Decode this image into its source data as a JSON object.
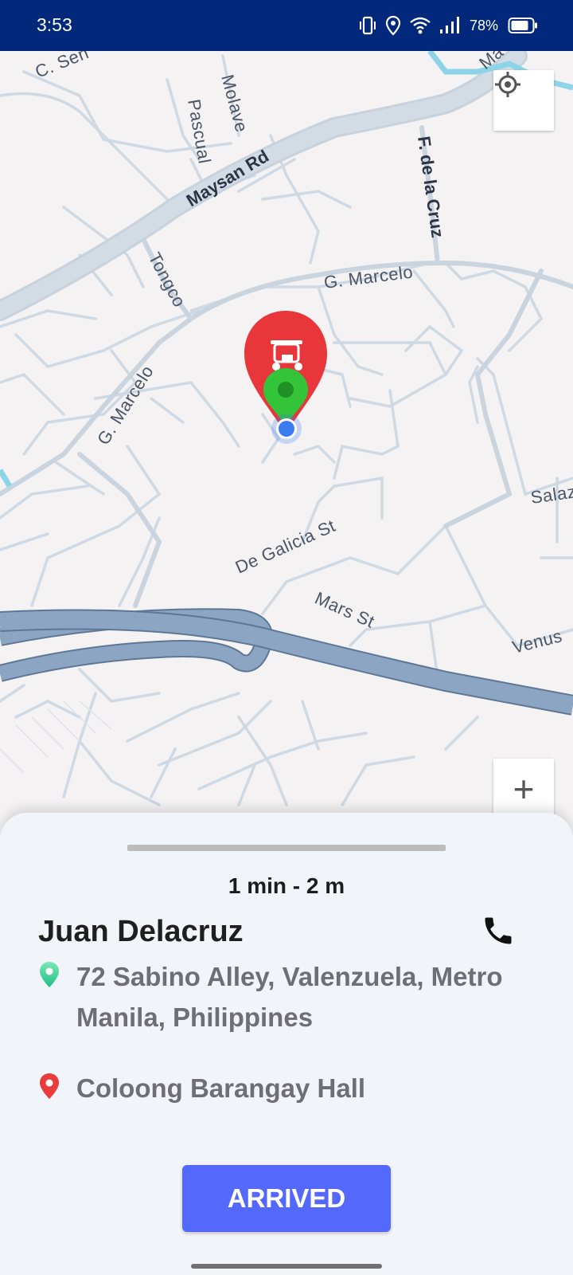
{
  "status_bar": {
    "time": "3:53",
    "battery_percent": "78%",
    "icons": [
      "vibrate-icon",
      "location-icon",
      "wifi-icon",
      "signal-icon",
      "battery-icon"
    ]
  },
  "map": {
    "roads": {
      "c_sen": "C. Sen",
      "molave": "Molave",
      "pascual": "Pascual",
      "maysan_rd": "Maysan Rd",
      "f_dela_cruz": "F. de la Cruz",
      "tongco": "Tongco",
      "g_marcelo_1": "G. Marcelo",
      "g_marcelo_2": "G. Marcelo",
      "salaz": "Salaz",
      "de_galicia": "De Galicia St",
      "mars": "Mars St",
      "venus": "Venus",
      "ma": "Ma"
    },
    "controls": {
      "zoom_in": "+",
      "zoom_out": "−"
    },
    "colors": {
      "marker_red": "#e8363b",
      "marker_green": "#34c43a",
      "user_dot": "#3d7bf0",
      "river": "#8aa4c4"
    }
  },
  "sheet": {
    "eta": "1 min - 2 m",
    "driver_name": "Juan Delacruz",
    "pickup_address": "72 Sabino Alley, Valenzuela, Metro Manila, Philippines",
    "dropoff_address": "Coloong Barangay Hall",
    "arrived_label": "ARRIVED"
  },
  "theme": {
    "status_bar_bg": "#01287a",
    "button_blue": "#5468fc",
    "pickup_pin_color": "#3fd39a",
    "dropoff_pin_color": "#ea3b3b"
  }
}
